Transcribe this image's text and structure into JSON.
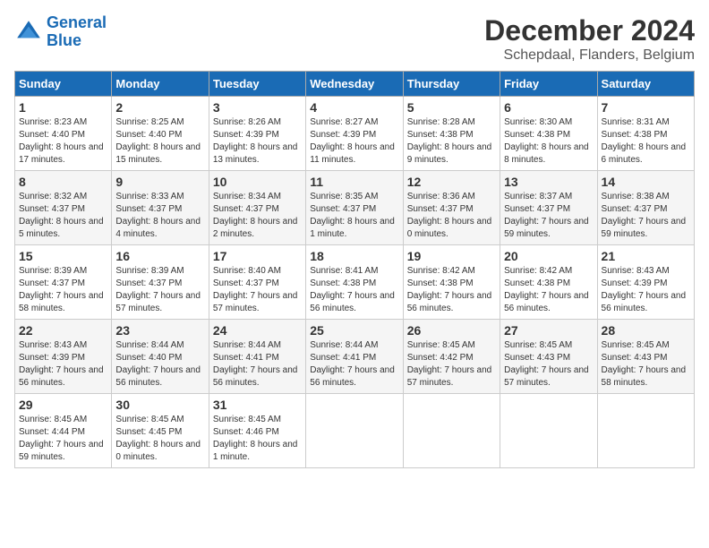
{
  "header": {
    "logo_line1": "General",
    "logo_line2": "Blue",
    "month_title": "December 2024",
    "location": "Schepdaal, Flanders, Belgium"
  },
  "weekdays": [
    "Sunday",
    "Monday",
    "Tuesday",
    "Wednesday",
    "Thursday",
    "Friday",
    "Saturday"
  ],
  "weeks": [
    [
      {
        "day": "1",
        "info": "Sunrise: 8:23 AM\nSunset: 4:40 PM\nDaylight: 8 hours and 17 minutes."
      },
      {
        "day": "2",
        "info": "Sunrise: 8:25 AM\nSunset: 4:40 PM\nDaylight: 8 hours and 15 minutes."
      },
      {
        "day": "3",
        "info": "Sunrise: 8:26 AM\nSunset: 4:39 PM\nDaylight: 8 hours and 13 minutes."
      },
      {
        "day": "4",
        "info": "Sunrise: 8:27 AM\nSunset: 4:39 PM\nDaylight: 8 hours and 11 minutes."
      },
      {
        "day": "5",
        "info": "Sunrise: 8:28 AM\nSunset: 4:38 PM\nDaylight: 8 hours and 9 minutes."
      },
      {
        "day": "6",
        "info": "Sunrise: 8:30 AM\nSunset: 4:38 PM\nDaylight: 8 hours and 8 minutes."
      },
      {
        "day": "7",
        "info": "Sunrise: 8:31 AM\nSunset: 4:38 PM\nDaylight: 8 hours and 6 minutes."
      }
    ],
    [
      {
        "day": "8",
        "info": "Sunrise: 8:32 AM\nSunset: 4:37 PM\nDaylight: 8 hours and 5 minutes."
      },
      {
        "day": "9",
        "info": "Sunrise: 8:33 AM\nSunset: 4:37 PM\nDaylight: 8 hours and 4 minutes."
      },
      {
        "day": "10",
        "info": "Sunrise: 8:34 AM\nSunset: 4:37 PM\nDaylight: 8 hours and 2 minutes."
      },
      {
        "day": "11",
        "info": "Sunrise: 8:35 AM\nSunset: 4:37 PM\nDaylight: 8 hours and 1 minute."
      },
      {
        "day": "12",
        "info": "Sunrise: 8:36 AM\nSunset: 4:37 PM\nDaylight: 8 hours and 0 minutes."
      },
      {
        "day": "13",
        "info": "Sunrise: 8:37 AM\nSunset: 4:37 PM\nDaylight: 7 hours and 59 minutes."
      },
      {
        "day": "14",
        "info": "Sunrise: 8:38 AM\nSunset: 4:37 PM\nDaylight: 7 hours and 59 minutes."
      }
    ],
    [
      {
        "day": "15",
        "info": "Sunrise: 8:39 AM\nSunset: 4:37 PM\nDaylight: 7 hours and 58 minutes."
      },
      {
        "day": "16",
        "info": "Sunrise: 8:39 AM\nSunset: 4:37 PM\nDaylight: 7 hours and 57 minutes."
      },
      {
        "day": "17",
        "info": "Sunrise: 8:40 AM\nSunset: 4:37 PM\nDaylight: 7 hours and 57 minutes."
      },
      {
        "day": "18",
        "info": "Sunrise: 8:41 AM\nSunset: 4:38 PM\nDaylight: 7 hours and 56 minutes."
      },
      {
        "day": "19",
        "info": "Sunrise: 8:42 AM\nSunset: 4:38 PM\nDaylight: 7 hours and 56 minutes."
      },
      {
        "day": "20",
        "info": "Sunrise: 8:42 AM\nSunset: 4:38 PM\nDaylight: 7 hours and 56 minutes."
      },
      {
        "day": "21",
        "info": "Sunrise: 8:43 AM\nSunset: 4:39 PM\nDaylight: 7 hours and 56 minutes."
      }
    ],
    [
      {
        "day": "22",
        "info": "Sunrise: 8:43 AM\nSunset: 4:39 PM\nDaylight: 7 hours and 56 minutes."
      },
      {
        "day": "23",
        "info": "Sunrise: 8:44 AM\nSunset: 4:40 PM\nDaylight: 7 hours and 56 minutes."
      },
      {
        "day": "24",
        "info": "Sunrise: 8:44 AM\nSunset: 4:41 PM\nDaylight: 7 hours and 56 minutes."
      },
      {
        "day": "25",
        "info": "Sunrise: 8:44 AM\nSunset: 4:41 PM\nDaylight: 7 hours and 56 minutes."
      },
      {
        "day": "26",
        "info": "Sunrise: 8:45 AM\nSunset: 4:42 PM\nDaylight: 7 hours and 57 minutes."
      },
      {
        "day": "27",
        "info": "Sunrise: 8:45 AM\nSunset: 4:43 PM\nDaylight: 7 hours and 57 minutes."
      },
      {
        "day": "28",
        "info": "Sunrise: 8:45 AM\nSunset: 4:43 PM\nDaylight: 7 hours and 58 minutes."
      }
    ],
    [
      {
        "day": "29",
        "info": "Sunrise: 8:45 AM\nSunset: 4:44 PM\nDaylight: 7 hours and 59 minutes."
      },
      {
        "day": "30",
        "info": "Sunrise: 8:45 AM\nSunset: 4:45 PM\nDaylight: 8 hours and 0 minutes."
      },
      {
        "day": "31",
        "info": "Sunrise: 8:45 AM\nSunset: 4:46 PM\nDaylight: 8 hours and 1 minute."
      },
      {
        "day": "",
        "info": ""
      },
      {
        "day": "",
        "info": ""
      },
      {
        "day": "",
        "info": ""
      },
      {
        "day": "",
        "info": ""
      }
    ]
  ]
}
